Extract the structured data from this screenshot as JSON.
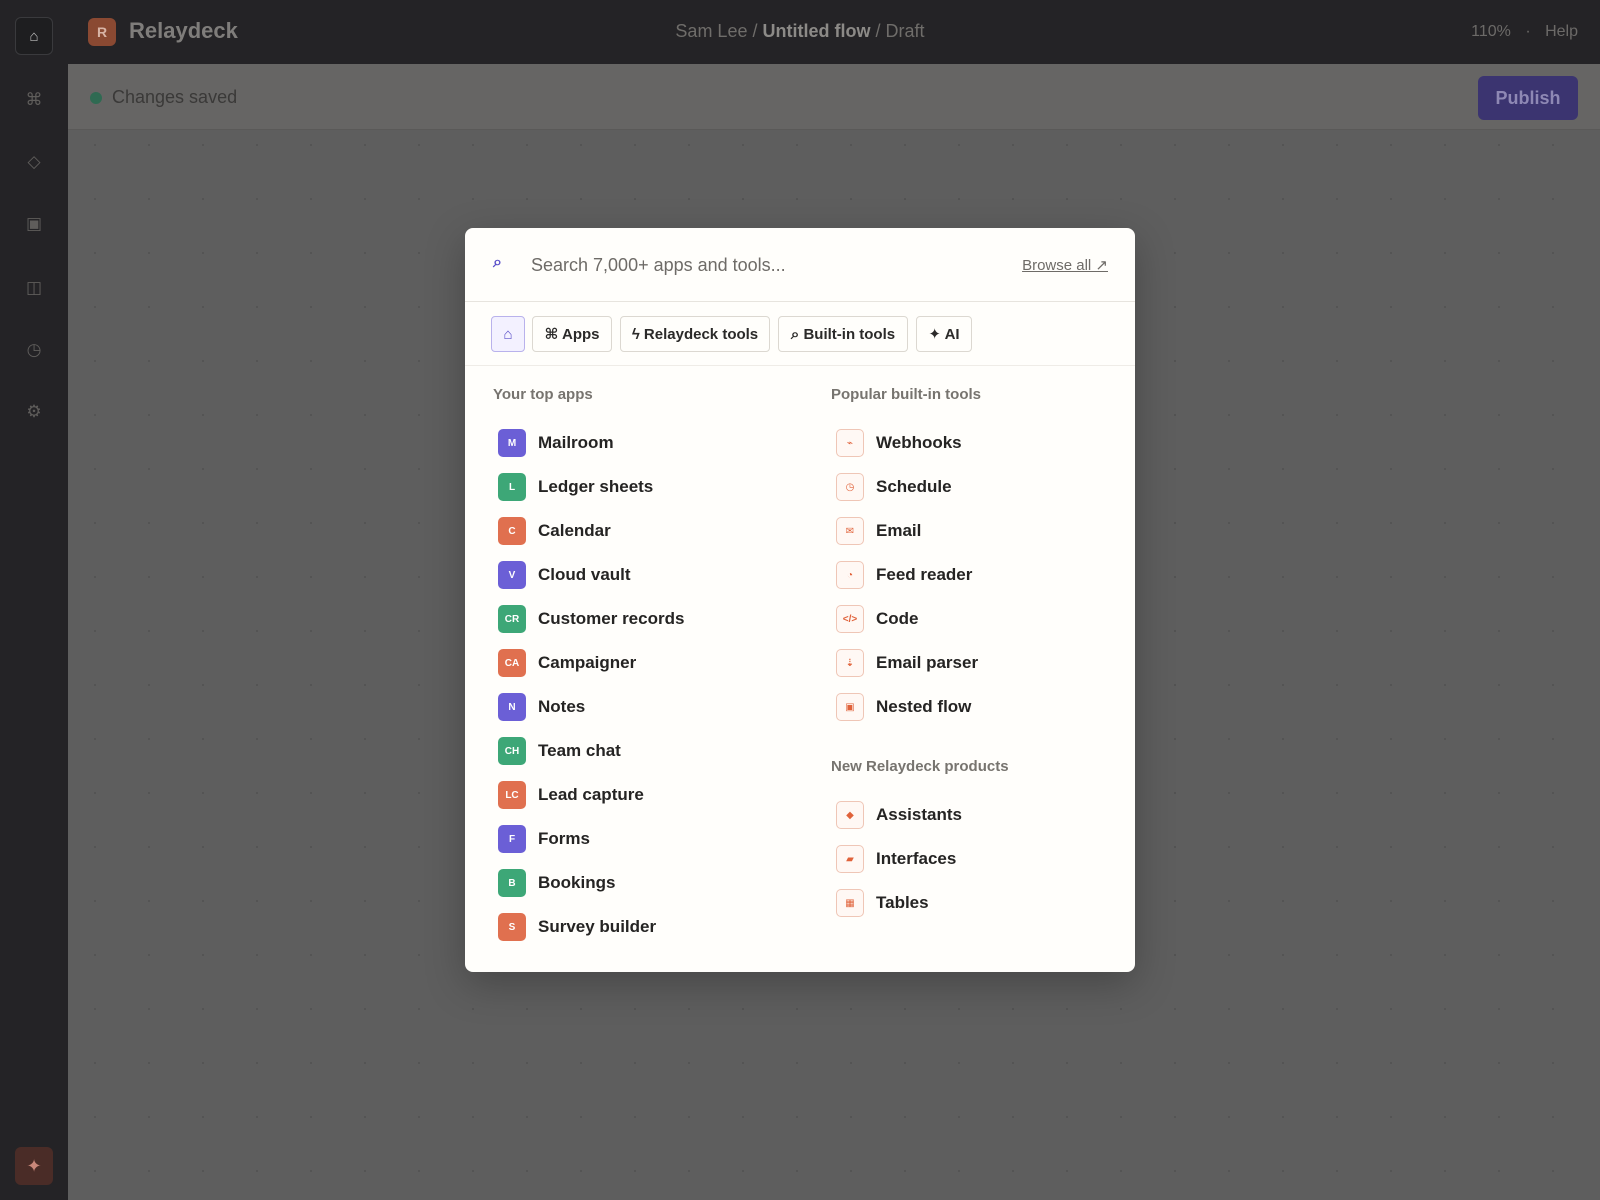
{
  "colors": {
    "purple": "#6b5fd6",
    "green": "#3da777",
    "orange": "#e0704f",
    "accent": "#5a50c9"
  },
  "topbar": {
    "brand_initial": "R",
    "brand_name": "Relaydeck",
    "breadcrumb_user": "Sam Lee",
    "breadcrumb_sep1": "/",
    "flow_name": "Untitled flow",
    "breadcrumb_sep2": "/",
    "flow_status": "Draft",
    "zoom": "110%",
    "separator": "·",
    "help": "Help"
  },
  "rail": {
    "icons": [
      "home-icon",
      "command-icon",
      "diamond-icon",
      "square-icon",
      "columns-icon",
      "clock-icon",
      "gear-icon",
      "sparkle-icon"
    ]
  },
  "statusbar": {
    "status_text": "Changes saved",
    "publish_label": "Publish"
  },
  "modal": {
    "search_placeholder": "Search 7,000+ apps and tools...",
    "browse_all": "Browse all ↗",
    "tabs": [
      {
        "label": "⌂",
        "icon": "home-icon"
      },
      {
        "label": "⌘ Apps"
      },
      {
        "label": "ϟ Relaydeck tools"
      },
      {
        "label": "⌕ Built-in tools"
      },
      {
        "label": "✦ AI"
      }
    ],
    "top_apps_heading": "Your top apps",
    "top_apps": [
      {
        "abbr": "M",
        "label": "Mailroom",
        "color": "purple"
      },
      {
        "abbr": "L",
        "label": "Ledger sheets",
        "color": "green"
      },
      {
        "abbr": "C",
        "label": "Calendar",
        "color": "orange"
      },
      {
        "abbr": "V",
        "label": "Cloud vault",
        "color": "purple"
      },
      {
        "abbr": "CR",
        "label": "Customer records",
        "color": "green"
      },
      {
        "abbr": "CA",
        "label": "Campaigner",
        "color": "orange"
      },
      {
        "abbr": "N",
        "label": "Notes",
        "color": "purple"
      },
      {
        "abbr": "CH",
        "label": "Team chat",
        "color": "green"
      },
      {
        "abbr": "LC",
        "label": "Lead capture",
        "color": "orange"
      },
      {
        "abbr": "F",
        "label": "Forms",
        "color": "purple"
      },
      {
        "abbr": "B",
        "label": "Bookings",
        "color": "green"
      },
      {
        "abbr": "S",
        "label": "Survey builder",
        "color": "orange"
      }
    ],
    "builtin_heading": "Popular built-in tools",
    "builtin_tools": [
      {
        "glyph": "⌁",
        "label": "Webhooks",
        "icon": "webhook-icon"
      },
      {
        "glyph": "◷",
        "label": "Schedule",
        "icon": "clock-icon"
      },
      {
        "glyph": "✉",
        "label": "Email",
        "icon": "envelope-icon"
      },
      {
        "glyph": "◔",
        "label": "Feed reader",
        "icon": "feed-icon"
      },
      {
        "glyph": "</>",
        "label": "Code",
        "icon": "code-icon"
      },
      {
        "glyph": "⇣",
        "label": "Email parser",
        "icon": "parser-icon"
      },
      {
        "glyph": "▣",
        "label": "Nested flow",
        "icon": "nested-flow-icon"
      }
    ],
    "products_heading": "New Relaydeck products",
    "products": [
      {
        "glyph": "◆",
        "label": "Assistants",
        "icon": "assistant-icon"
      },
      {
        "glyph": "▰",
        "label": "Interfaces",
        "icon": "interface-icon"
      },
      {
        "glyph": "▦",
        "label": "Tables",
        "icon": "table-icon"
      }
    ]
  }
}
